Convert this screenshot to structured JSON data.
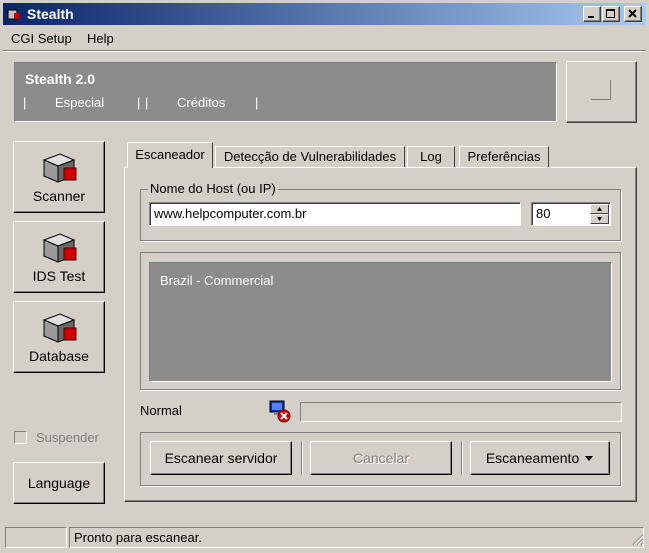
{
  "window": {
    "title": "Stealth"
  },
  "menu": [
    "CGI Setup",
    "Help"
  ],
  "banner": {
    "title": "Stealth 2.0",
    "nav": [
      "Especial",
      "Créditos"
    ],
    "separator": "|"
  },
  "sidebar": {
    "buttons": [
      {
        "label": "Scanner",
        "icon": "scanner-icon"
      },
      {
        "label": "IDS Test",
        "icon": "ids-test-icon"
      },
      {
        "label": "Database",
        "icon": "database-icon"
      }
    ],
    "suspend_label": "Suspender",
    "language_label": "Language"
  },
  "tabs": [
    {
      "label": "Escaneador",
      "active": true
    },
    {
      "label": "Detecção de Vulnerabilidades",
      "active": false
    },
    {
      "label": "Log",
      "active": false
    },
    {
      "label": "Preferências",
      "active": false
    }
  ],
  "host": {
    "group_label": "Nome do Host (ou IP)",
    "value": "www.helpcomputer.com.br",
    "port": "80"
  },
  "results": {
    "lines": [
      "Brazil - Commercial"
    ]
  },
  "status": {
    "label": "Normal",
    "progress": 0
  },
  "actions": {
    "scan": "Escanear servidor",
    "cancel": "Cancelar",
    "scan_menu": "Escaneamento"
  },
  "statusbar": {
    "left": "",
    "message": "Pronto para escanear."
  },
  "colors": {
    "titlebar_start": "#0a246a",
    "titlebar_end": "#a6caf0",
    "panel": "#8c8c8c",
    "face": "#d4d0c8"
  }
}
